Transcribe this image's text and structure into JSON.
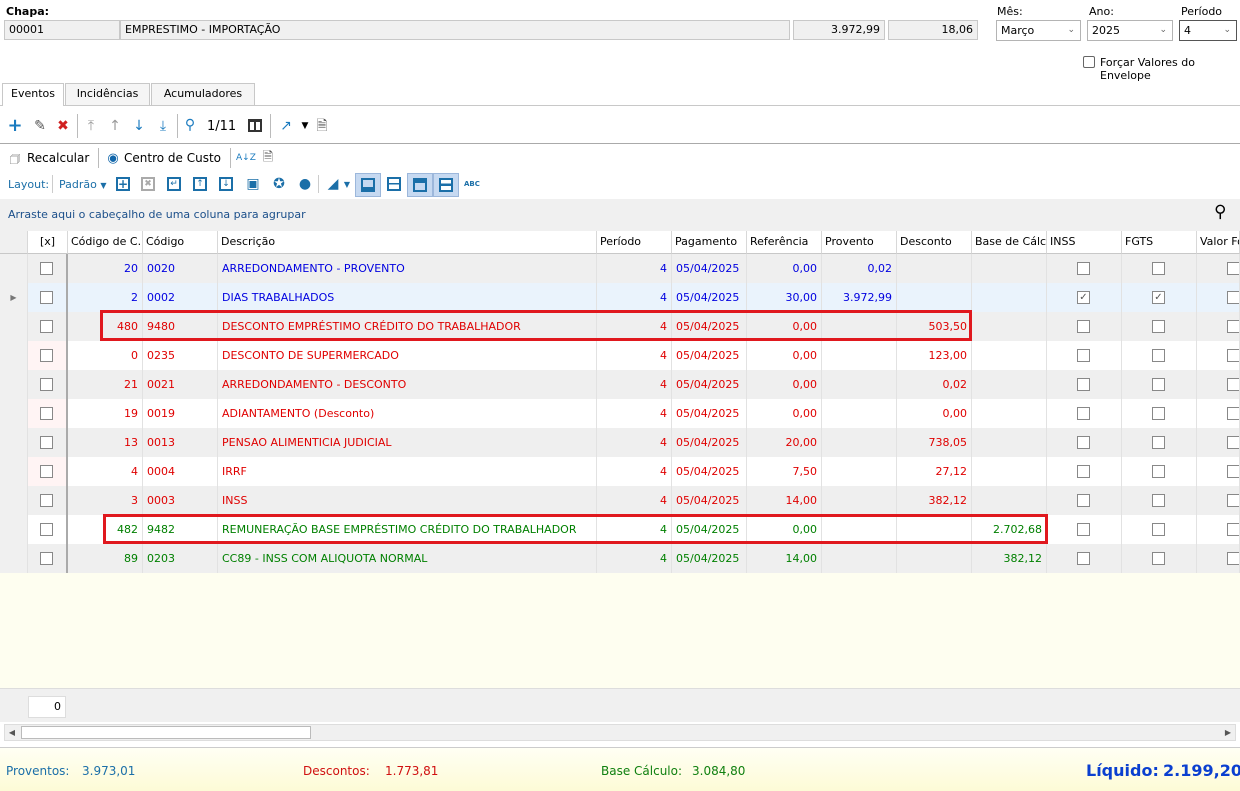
{
  "header": {
    "chapa_label": "Chapa:",
    "chapa": "00001",
    "description": "EMPRESTIMO - IMPORTAÇÃO",
    "value1": "3.972,99",
    "value2": "18,06",
    "mes_label": "Mês:",
    "mes": "Março",
    "ano_label": "Ano:",
    "ano": "2025",
    "periodo_label": "Período",
    "periodo": "4",
    "forcar_label": "Forçar Valores do Envelope"
  },
  "tabs": [
    "Eventos",
    "Incidências",
    "Acumuladores"
  ],
  "toolbar": {
    "record_counter": "1/11",
    "recalcular": "Recalcular",
    "centro_custo": "Centro de Custo",
    "layout_label": "Layout:",
    "layout_value": "Padrão"
  },
  "group_hint": "Arraste aqui o cabeçalho de uma coluna para agrupar",
  "columns": [
    "[x]",
    "Código de C...",
    "Código",
    "Descrição",
    "Período",
    "Pagamento",
    "Referência",
    "Provento",
    "Desconto",
    "Base de Cálc...",
    "INSS",
    "FGTS",
    "Valor Fo"
  ],
  "rows": [
    {
      "cc": "20",
      "cod": "0020",
      "desc": "ARREDONDAMENTO - PROVENTO",
      "per": "4",
      "pag": "05/04/2025",
      "ref": "0,00",
      "prov": "0,02",
      "desc_val": "",
      "base": "",
      "inss": false,
      "fgts": false,
      "type": "prov"
    },
    {
      "cc": "2",
      "cod": "0002",
      "desc": "DIAS TRABALHADOS",
      "per": "4",
      "pag": "05/04/2025",
      "ref": "30,00",
      "prov": "3.972,99",
      "desc_val": "",
      "base": "",
      "inss": true,
      "fgts": true,
      "type": "prov"
    },
    {
      "cc": "480",
      "cod": "9480",
      "desc": "DESCONTO EMPRÉSTIMO CRÉDITO DO TRABALHADOR",
      "per": "4",
      "pag": "05/04/2025",
      "ref": "0,00",
      "prov": "",
      "desc_val": "503,50",
      "base": "",
      "inss": false,
      "fgts": false,
      "type": "desc"
    },
    {
      "cc": "0",
      "cod": "0235",
      "desc": "DESCONTO DE SUPERMERCADO",
      "per": "4",
      "pag": "05/04/2025",
      "ref": "0,00",
      "prov": "",
      "desc_val": "123,00",
      "base": "",
      "inss": false,
      "fgts": false,
      "type": "desc"
    },
    {
      "cc": "21",
      "cod": "0021",
      "desc": "ARREDONDAMENTO - DESCONTO",
      "per": "4",
      "pag": "05/04/2025",
      "ref": "0,00",
      "prov": "",
      "desc_val": "0,02",
      "base": "",
      "inss": false,
      "fgts": false,
      "type": "desc"
    },
    {
      "cc": "19",
      "cod": "0019",
      "desc": "ADIANTAMENTO (Desconto)",
      "per": "4",
      "pag": "05/04/2025",
      "ref": "0,00",
      "prov": "",
      "desc_val": "0,00",
      "base": "",
      "inss": false,
      "fgts": false,
      "type": "desc"
    },
    {
      "cc": "13",
      "cod": "0013",
      "desc": "PENSAO ALIMENTICIA JUDICIAL",
      "per": "4",
      "pag": "05/04/2025",
      "ref": "20,00",
      "prov": "",
      "desc_val": "738,05",
      "base": "",
      "inss": false,
      "fgts": false,
      "type": "desc"
    },
    {
      "cc": "4",
      "cod": "0004",
      "desc": "IRRF",
      "per": "4",
      "pag": "05/04/2025",
      "ref": "7,50",
      "prov": "",
      "desc_val": "27,12",
      "base": "",
      "inss": false,
      "fgts": false,
      "type": "desc"
    },
    {
      "cc": "3",
      "cod": "0003",
      "desc": "INSS",
      "per": "4",
      "pag": "05/04/2025",
      "ref": "14,00",
      "prov": "",
      "desc_val": "382,12",
      "base": "",
      "inss": false,
      "fgts": false,
      "type": "desc"
    },
    {
      "cc": "482",
      "cod": "9482",
      "desc": "REMUNERAÇÃO BASE EMPRÉSTIMO CRÉDITO DO TRABALHADOR",
      "per": "4",
      "pag": "05/04/2025",
      "ref": "0,00",
      "prov": "",
      "desc_val": "",
      "base": "2.702,68",
      "inss": false,
      "fgts": false,
      "type": "base"
    },
    {
      "cc": "89",
      "cod": "0203",
      "desc": "CC89 - INSS COM ALIQUOTA NORMAL",
      "per": "4",
      "pag": "05/04/2025",
      "ref": "14,00",
      "prov": "",
      "desc_val": "",
      "base": "382,12",
      "inss": false,
      "fgts": false,
      "type": "base"
    }
  ],
  "footer_count": "0",
  "summary": {
    "proventos_label": "Proventos:",
    "proventos": "3.973,01",
    "descontos_label": "Descontos:",
    "descontos": "1.773,81",
    "base_label": "Base Cálculo:",
    "base": "3.084,80",
    "liquido_label": "Líquido:",
    "liquido": "2.199,20"
  },
  "colors": {
    "provento": "#0000e0",
    "desconto": "#e00000",
    "base": "#008000",
    "highlight": "#e0181e"
  }
}
